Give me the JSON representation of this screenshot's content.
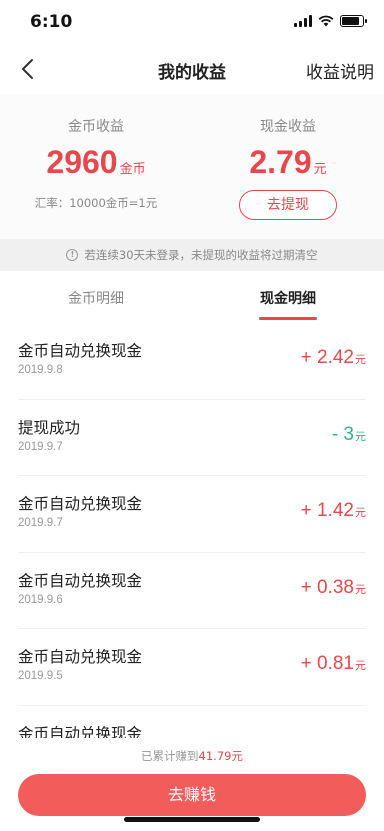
{
  "status_bar": {
    "time": "6:10",
    "battery_level": 0.85
  },
  "nav": {
    "title": "我的收益",
    "right_link": "收益说明"
  },
  "summary": {
    "coin": {
      "title": "金币收益",
      "value": "2960",
      "unit": "金币"
    },
    "cash": {
      "title": "现金收益",
      "value": "2.79",
      "unit": "元"
    },
    "rate_text": "汇率：10000金币=1元",
    "withdraw_label": "去提现"
  },
  "notice": "若连续30天未登录，未提现的收益将过期清空",
  "tabs": [
    {
      "label": "金币明细",
      "active": false
    },
    {
      "label": "现金明细",
      "active": true
    }
  ],
  "transactions": [
    {
      "title": "金币自动兑换现金",
      "date": "2019.9.8",
      "amount": "+ 2.42",
      "currency": "元",
      "type": "income"
    },
    {
      "title": "提现成功",
      "date": "2019.9.7",
      "amount": "- 3",
      "currency": "元",
      "type": "withdraw"
    },
    {
      "title": "金币自动兑换现金",
      "date": "2019.9.7",
      "amount": "+ 1.42",
      "currency": "元",
      "type": "income"
    },
    {
      "title": "金币自动兑换现金",
      "date": "2019.9.6",
      "amount": "+ 0.38",
      "currency": "元",
      "type": "income"
    },
    {
      "title": "金币自动兑换现金",
      "date": "2019.9.5",
      "amount": "+ 0.81",
      "currency": "元",
      "type": "income"
    },
    {
      "title": "金币自动兑换现金",
      "date": "",
      "amount": "",
      "currency": "",
      "type": "income"
    }
  ],
  "footer": {
    "total_prefix": "已累计赚到",
    "total_amount": "41.79元",
    "button_label": "去赚钱"
  },
  "colors": {
    "accent": "#e6484d",
    "button": "#f25c5a",
    "withdraw": "#2db58a"
  }
}
